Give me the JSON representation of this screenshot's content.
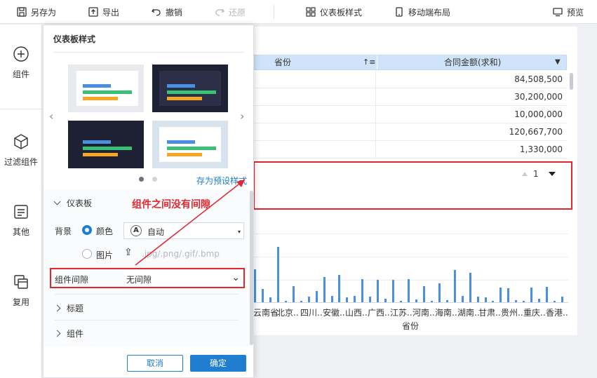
{
  "toolbar": {
    "save_as": "另存为",
    "export": "导出",
    "undo": "撤销",
    "redo": "还原",
    "dashboard_style": "仪表板样式",
    "mobile_layout": "移动端布局",
    "preview": "预览"
  },
  "sidebar": {
    "components": "组件",
    "filter_components": "过滤组件",
    "other": "其他",
    "reuse": "复用"
  },
  "table": {
    "col_province": "省份",
    "col_amount": "合同金额(求和)",
    "values": [
      "84,508,500",
      "30,200,000",
      "10,000,000",
      "120,667,700",
      "1,330,000"
    ]
  },
  "pager": {
    "page": "1"
  },
  "chart_labels": {
    "x_ticks": [
      "云南省",
      "北京..",
      "四川..",
      "安徽..",
      "山西..",
      "广西..",
      "江苏..",
      "河南..",
      "海南..",
      "湖南..",
      "甘肃..",
      "贵州..",
      "重庆..",
      "香港.."
    ],
    "x_title": "省份"
  },
  "bars": [
    0.55,
    0.22,
    0.08,
    0.93,
    0.02,
    0.27,
    0.02,
    0.1,
    0.19,
    0.42,
    0.11,
    0.46,
    0.08,
    0.11,
    0.39,
    0.09,
    0.38,
    0.06,
    0.38,
    0.02,
    0.39,
    0.05,
    0.27,
    0.02,
    0.32,
    0.04,
    0.54,
    0.11,
    0.5,
    0.1,
    0.08,
    0.02,
    0.25,
    0.24,
    0.04,
    0.02,
    0.25,
    0.06,
    0.26,
    0.02,
    0.1
  ],
  "dialog": {
    "title": "仪表板样式",
    "save_preset": "存为预设样式",
    "section_dashboard": "仪表板",
    "background_label": "背景",
    "color_option": "颜色",
    "auto_value": "自动",
    "image_option": "图片",
    "image_hint": ".jpg/.png/.gif/.bmp",
    "spacing_label": "组件间隙",
    "spacing_value": "无间隙",
    "section_title": "标题",
    "section_component": "组件",
    "cancel": "取消",
    "confirm": "确定"
  },
  "annotation": "组件之间没有间隙",
  "colors": {
    "accent": "#1f7ed0",
    "annotation_red": "#e0262f",
    "bar_blue": "#4a90e2",
    "header_blue": "#cfe4fa"
  }
}
